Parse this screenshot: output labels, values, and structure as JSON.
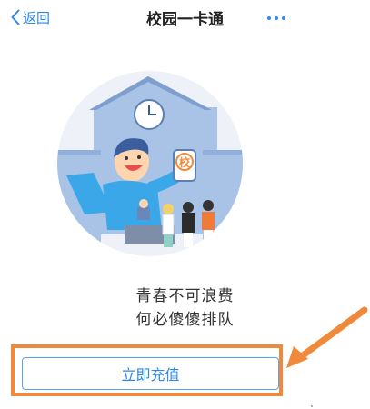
{
  "navbar": {
    "back_label": "返回",
    "title": "校园一卡通",
    "more_icon": "more-dots-icon"
  },
  "hero": {
    "card_char": "校",
    "clock_icon": "clock-icon"
  },
  "slogan": {
    "line1": "青春不可浪费",
    "line2": "何必傻傻排队"
  },
  "actions": {
    "recharge_label": "立即充值"
  },
  "colors": {
    "accent": "#2d88ef",
    "annotation": "#f08a3a"
  }
}
